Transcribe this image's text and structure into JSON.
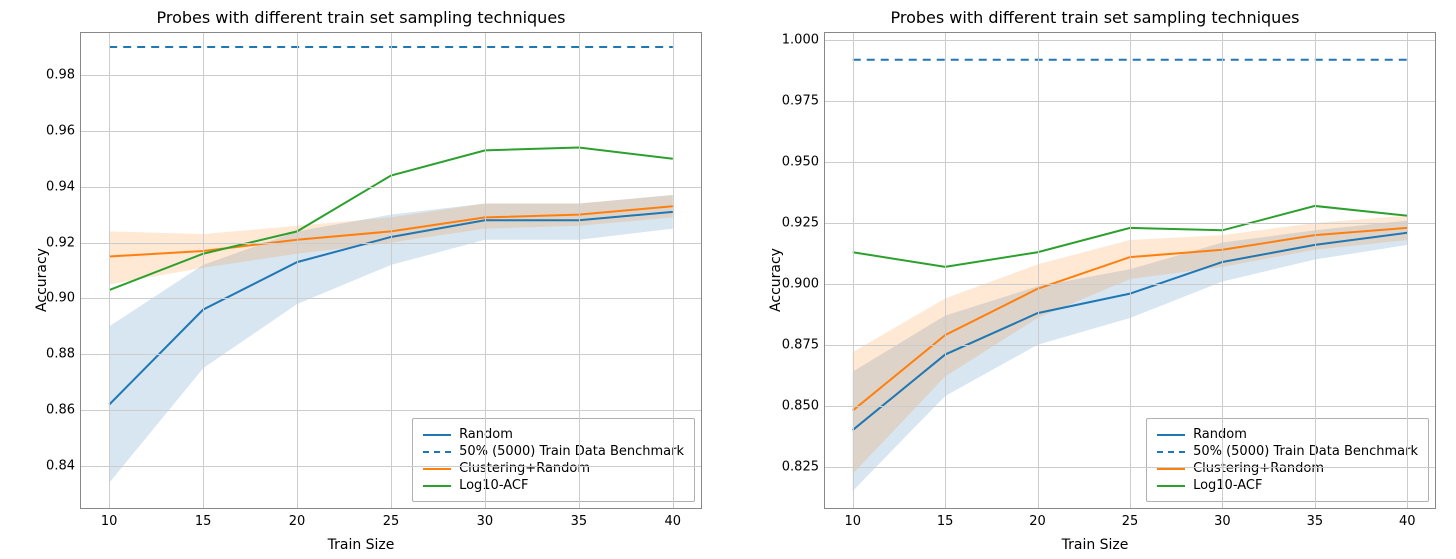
{
  "chart_data": [
    {
      "type": "line",
      "title": "Probes with different train set sampling techniques",
      "xlabel": "Train Size",
      "ylabel": "Accuracy",
      "x": [
        10,
        15,
        20,
        25,
        30,
        35,
        40
      ],
      "yticks": [
        0.84,
        0.86,
        0.88,
        0.9,
        0.92,
        0.94,
        0.96,
        0.98
      ],
      "ylim": [
        0.825,
        0.995
      ],
      "xlim": [
        8.5,
        41.5
      ],
      "xticks": [
        10,
        15,
        20,
        25,
        30,
        35,
        40
      ],
      "series": [
        {
          "name": "Random",
          "color": "#1f77b4",
          "style": "solid",
          "values": [
            0.862,
            0.896,
            0.913,
            0.922,
            0.928,
            0.928,
            0.931
          ],
          "lower": [
            0.834,
            0.875,
            0.898,
            0.912,
            0.921,
            0.921,
            0.925
          ],
          "upper": [
            0.89,
            0.912,
            0.924,
            0.93,
            0.934,
            0.934,
            0.937
          ]
        },
        {
          "name": "50% (5000) Train Data Benchmark",
          "color": "#1f77b4",
          "style": "dashed",
          "values": [
            0.99,
            0.99,
            0.99,
            0.99,
            0.99,
            0.99,
            0.99
          ]
        },
        {
          "name": "Clustering+Random",
          "color": "#ff7f0e",
          "style": "solid",
          "values": [
            0.915,
            0.917,
            0.921,
            0.924,
            0.929,
            0.93,
            0.933
          ],
          "lower": [
            0.905,
            0.911,
            0.916,
            0.92,
            0.925,
            0.926,
            0.929
          ],
          "upper": [
            0.924,
            0.923,
            0.926,
            0.929,
            0.934,
            0.934,
            0.937
          ]
        },
        {
          "name": "Log10-ACF",
          "color": "#2ca02c",
          "style": "solid",
          "values": [
            0.903,
            0.916,
            0.924,
            0.944,
            0.953,
            0.954,
            0.95
          ]
        }
      ],
      "legend": [
        "Random",
        "50% (5000) Train Data Benchmark",
        "Clustering+Random",
        "Log10-ACF"
      ]
    },
    {
      "type": "line",
      "title": "Probes with different train set sampling techniques",
      "xlabel": "Train Size",
      "ylabel": "Accuracy",
      "x": [
        10,
        15,
        20,
        25,
        30,
        35,
        40
      ],
      "yticks": [
        0.825,
        0.85,
        0.875,
        0.9,
        0.925,
        0.95,
        0.975,
        1.0
      ],
      "ylim": [
        0.808,
        1.003
      ],
      "xlim": [
        8.5,
        41.5
      ],
      "xticks": [
        10,
        15,
        20,
        25,
        30,
        35,
        40
      ],
      "series": [
        {
          "name": "Random",
          "color": "#1f77b4",
          "style": "solid",
          "values": [
            0.84,
            0.871,
            0.888,
            0.896,
            0.909,
            0.916,
            0.921
          ],
          "lower": [
            0.815,
            0.854,
            0.875,
            0.886,
            0.901,
            0.91,
            0.916
          ],
          "upper": [
            0.864,
            0.887,
            0.899,
            0.906,
            0.917,
            0.922,
            0.926
          ]
        },
        {
          "name": "50% (5000) Train Data Benchmark",
          "color": "#1f77b4",
          "style": "dashed",
          "values": [
            0.992,
            0.992,
            0.992,
            0.992,
            0.992,
            0.992,
            0.992
          ]
        },
        {
          "name": "Clustering+Random",
          "color": "#ff7f0e",
          "style": "solid",
          "values": [
            0.848,
            0.879,
            0.898,
            0.911,
            0.914,
            0.92,
            0.923
          ],
          "lower": [
            0.822,
            0.862,
            0.886,
            0.902,
            0.907,
            0.914,
            0.918
          ],
          "upper": [
            0.872,
            0.894,
            0.908,
            0.918,
            0.92,
            0.925,
            0.928
          ]
        },
        {
          "name": "Log10-ACF",
          "color": "#2ca02c",
          "style": "solid",
          "values": [
            0.913,
            0.907,
            0.913,
            0.923,
            0.922,
            0.932,
            0.928
          ]
        }
      ],
      "legend": [
        "Random",
        "50% (5000) Train Data Benchmark",
        "Clustering+Random",
        "Log10-ACF"
      ]
    }
  ]
}
